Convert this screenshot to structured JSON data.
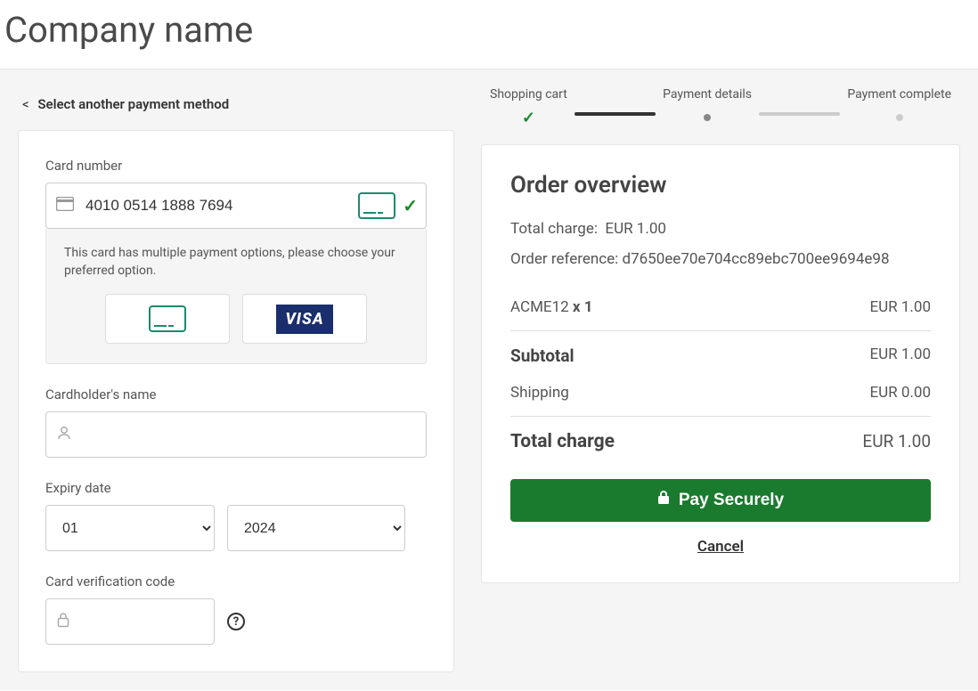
{
  "header": {
    "title": "Company name"
  },
  "back_link": {
    "chevron": "<",
    "label": "Select another payment method"
  },
  "progress": {
    "steps": [
      {
        "label": "Shopping cart"
      },
      {
        "label": "Payment details"
      },
      {
        "label": "Payment complete"
      }
    ]
  },
  "form": {
    "card_number": {
      "label": "Card number",
      "value": "4010 0514 1888 7694"
    },
    "options": {
      "message": "This card has multiple payment options, please choose your preferred option.",
      "visa_label": "VISA"
    },
    "cardholder": {
      "label": "Cardholder's name",
      "value": ""
    },
    "expiry": {
      "label": "Expiry date",
      "month": "01",
      "year": "2024"
    },
    "cvv": {
      "label": "Card verification code",
      "help": "?"
    }
  },
  "overview": {
    "title": "Order overview",
    "total_charge_label": "Total charge:",
    "total_charge_value": "EUR 1.00",
    "order_ref_label": "Order reference:",
    "order_ref_value": "d7650ee70e704cc89ebc700ee9694e98",
    "items": [
      {
        "name": "ACME12",
        "qty": "x 1",
        "price": "EUR 1.00"
      }
    ],
    "subtotal_label": "Subtotal",
    "subtotal_value": "EUR 1.00",
    "shipping_label": "Shipping",
    "shipping_value": "EUR 0.00",
    "total_label": "Total charge",
    "total_value": "EUR 1.00",
    "pay_label": "Pay Securely",
    "cancel_label": "Cancel"
  }
}
